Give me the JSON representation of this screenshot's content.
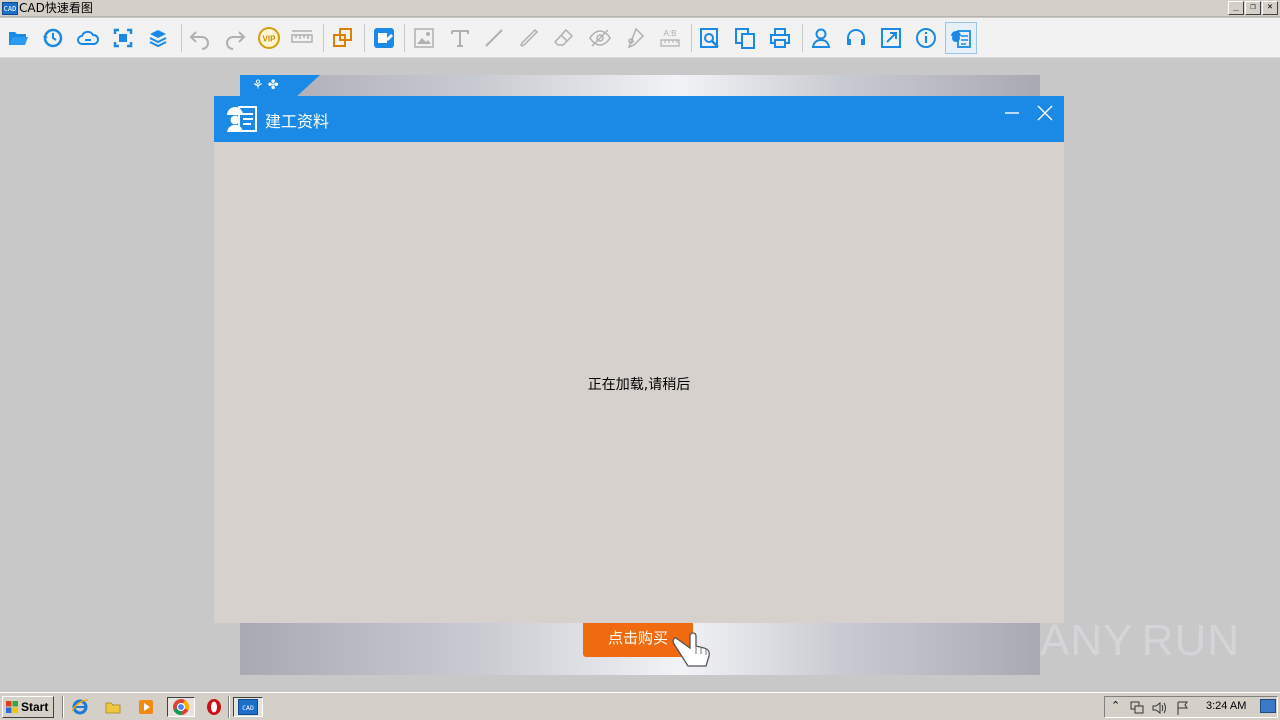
{
  "window": {
    "title": "CAD快速看图",
    "app_icon_text": "CAD"
  },
  "toolbar": {
    "icons": [
      "open-folder-icon",
      "history-icon",
      "cloud-icon",
      "fit-view-icon",
      "layers-icon",
      "undo-icon",
      "redo-icon",
      "vip-icon",
      "measure-icon",
      "compare-icon",
      "cad-convert-icon",
      "insert-image-icon",
      "text-icon",
      "line-icon",
      "pen-icon",
      "eraser-icon",
      "hide-icon",
      "tag-icon",
      "ab-icon",
      "search-drawing-icon",
      "export-icon",
      "print-icon",
      "user-icon",
      "support-icon",
      "share-icon",
      "info-icon",
      "construction-docs-icon"
    ]
  },
  "banner": {
    "tab_text": "⚘ ✤"
  },
  "dialog": {
    "title": "建工资料",
    "loading_text": "正在加载,请稍后"
  },
  "buy_button": {
    "label": "点击购买"
  },
  "watermark": {
    "text_left": "ANY",
    "text_right": "RUN"
  },
  "taskbar": {
    "start_label": "Start",
    "clock": "3:24 AM",
    "app_button_text": "CAD"
  },
  "colors": {
    "accent": "#1a8ae6",
    "buy_orange": "#f06a0f",
    "dialog_bg": "#d6d1cc"
  }
}
